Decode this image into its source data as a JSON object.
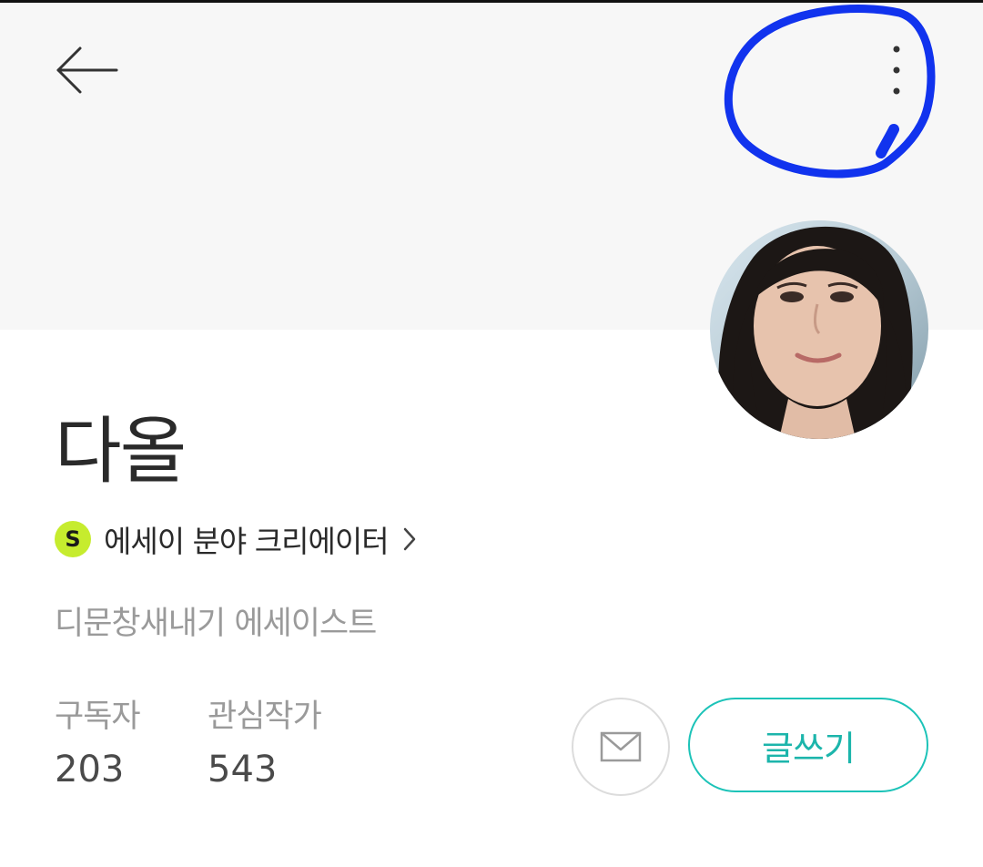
{
  "header": {
    "back_icon": "arrow-left-icon",
    "more_icon": "vertical-dots-icon",
    "annotation_color": "#1133ee"
  },
  "profile": {
    "name": "다올",
    "creator_badge": "S",
    "creator_label": "에세이 분야 크리에이터",
    "creator_badge_color": "#c6ec2e",
    "bio": "디문창새내기 에세이스트"
  },
  "stats": {
    "subscribers_label": "구독자",
    "subscribers_value": "203",
    "following_label": "관심작가",
    "following_value": "543"
  },
  "actions": {
    "mail_icon": "envelope-icon",
    "write_label": "글쓰기",
    "accent_color": "#1cc3b8"
  }
}
